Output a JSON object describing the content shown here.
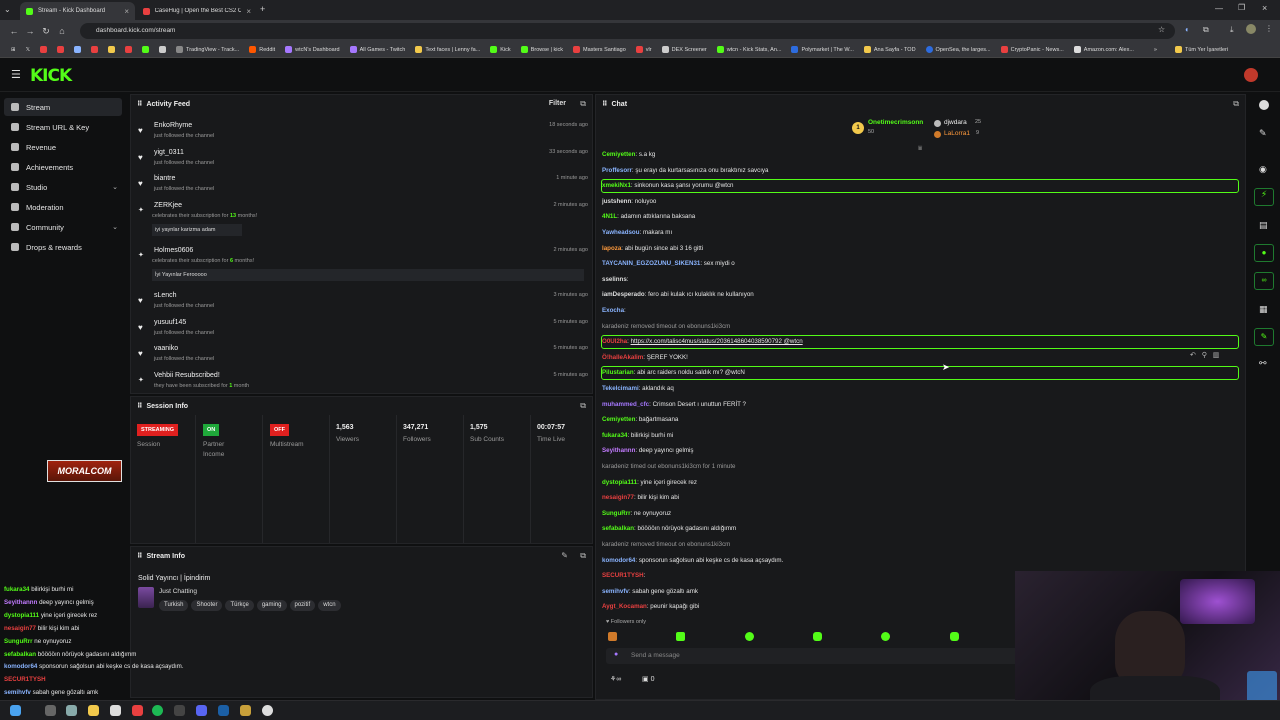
{
  "browser": {
    "tabs": [
      {
        "title": "Stream - Kick Dashboard",
        "active": true
      },
      {
        "title": "CaseHug | Open the Best CS2 C",
        "active": false
      }
    ],
    "url": "dashboard.kick.com/stream",
    "bookmarks": [
      "TradingView - Track...",
      "Reddit",
      "wtcN's Dashboard",
      "All Games - Twitch",
      "Text faces | Lenny fa...",
      "Kick",
      "Browse | kick",
      "Masters Santiago",
      "vlr",
      "DEX Screener",
      "wtcn - Kick Stats, An...",
      "Polymarket | The W...",
      "Ana Sayfa - TOD",
      "OpenSea, the larges...",
      "CryptoPanic - News...",
      "Amazon.com: Alex...",
      "Tüm Yer İşaretleri"
    ]
  },
  "header": {
    "logo": "KICK"
  },
  "sidebar": {
    "items": [
      {
        "label": "Stream",
        "active": true
      },
      {
        "label": "Stream URL & Key"
      },
      {
        "label": "Revenue"
      },
      {
        "label": "Achievements"
      },
      {
        "label": "Studio",
        "chevron": "⌄"
      },
      {
        "label": "Moderation"
      },
      {
        "label": "Community",
        "chevron": "⌄"
      },
      {
        "label": "Drops & rewards"
      }
    ]
  },
  "activity": {
    "title": "Activity Feed",
    "filter": "Filter",
    "items": [
      {
        "name": "EnkoRhyme",
        "desc": "just followed the channel",
        "time": "18 seconds ago"
      },
      {
        "name": "yigt_0311",
        "desc": "just followed the channel",
        "time": "33 seconds ago"
      },
      {
        "name": "biantre",
        "desc": "just followed the channel",
        "time": "1 minute ago"
      },
      {
        "name": "ZERKjee",
        "desc_pre": "celebrates their subscription for ",
        "months": "13",
        "desc_post": " months!",
        "time": "2 minutes ago",
        "msg": "iyi yaynlar karizma adam"
      },
      {
        "name": "Holmes0606",
        "desc_pre": "celebrates their subscription for ",
        "months": "6",
        "desc_post": " months!",
        "time": "2 minutes ago",
        "msg": "İyi Yayınlar Ferooooo"
      },
      {
        "name": "sLench",
        "desc": "just followed the channel",
        "time": "3 minutes ago"
      },
      {
        "name": "yusuuf145",
        "desc": "just followed the channel",
        "time": "5 minutes ago"
      },
      {
        "name": "vaaniko",
        "desc": "just followed the channel",
        "time": "5 minutes ago"
      },
      {
        "name": "Vehbii Resubscribed!",
        "desc_pre": "they have been subscribed for ",
        "months": "1",
        "desc_post": " month",
        "time": "5 minutes ago"
      }
    ]
  },
  "session": {
    "title": "Session Info",
    "streaming_badge": "STREAMING",
    "session_label": "Session",
    "partner_badge": "ON",
    "partner_label": "Partner Income",
    "multistream_badge": "OFF",
    "multistream_label": "Multistream",
    "viewers": "1,563",
    "viewers_label": "Viewers",
    "followers": "347,271",
    "followers_label": "Followers",
    "subs": "1,575",
    "subs_label": "Sub Counts",
    "time_live": "00:07:57",
    "time_live_label": "Time Live"
  },
  "stream_info": {
    "title": "Stream Info",
    "stream_title": "Solid Yayıncı | İpindirim",
    "category": "Just Chatting",
    "tags": [
      "Turkish",
      "Shooter",
      "Türkçe",
      "gaming",
      "pozitif",
      "wtcn"
    ]
  },
  "chat": {
    "title": "Chat",
    "top_gifters": [
      {
        "name": "Onetimecrimsonn",
        "count": "50"
      },
      {
        "name": "djwdara",
        "count": "25"
      },
      {
        "name": "LaLorra1",
        "count": "9"
      }
    ],
    "placeholder": "Send a message",
    "followers_only": "Followers only",
    "footer_count": "0",
    "messages": [
      {
        "user": "Cemiyetten",
        "text": "s.a kg",
        "color": "#53fc18"
      },
      {
        "user": "Proffesorr",
        "text": "şu erayı da kurtarsasınıza onu bıraktınız savcıya",
        "color": "#8ab4ff"
      },
      {
        "user": "xmekiNx1",
        "text": "sinkonun kasa şansı yorumu @wtcn",
        "color": "#53fc18",
        "highlight": true
      },
      {
        "user": "justshenn",
        "text": "noluyoo",
        "color": "#dddddd"
      },
      {
        "user": "4N1L",
        "text": "adamın attıklarına baksana",
        "color": "#53fc18"
      },
      {
        "user": "Yawheadsou",
        "text": "makara mı",
        "color": "#8ab4ff"
      },
      {
        "user": "lapoza",
        "text": "abi bugün since abi 3 16 gitti",
        "color": "#ff9a3c"
      },
      {
        "user": "TAYCANIN_EGZOZUNU_SIKEN31",
        "text": "sex miydi o",
        "color": "#8ab4ff"
      },
      {
        "user": "sselinns",
        "text": "",
        "color": "#dddddd"
      },
      {
        "user": "iamDesperado",
        "text": "fero abi kulak ıcı kulaklık ne kullanıyon",
        "color": "#dddddd"
      },
      {
        "user": "Exocha",
        "text": "",
        "color": "#8ab4ff"
      },
      {
        "user": "karadeniz",
        "text": "removed timeout on ebonuns1ki3cm",
        "system": true
      },
      {
        "user": "O0UI2ha",
        "text": "https://x.com/talisc4mus/status/2036148604038590792 @wtcn",
        "color": "#e94040",
        "highlight": true,
        "link": true
      },
      {
        "user": "Ö!halleAkalim",
        "text": "ŞEREF YOKK!",
        "color": "#e94040"
      },
      {
        "user": "Pilustarian",
        "text": "abi arc raiders noldu saldık mı? @wtcN",
        "color": "#53fc18",
        "highlight": true
      },
      {
        "user": "Tekelcimami",
        "text": "aklandık aq",
        "color": "#8ab4ff"
      },
      {
        "user": "muhammed_cfc",
        "text": "Crimson Desert ı unuttun FERİT ?",
        "color": "#a678ff"
      },
      {
        "user": "Cemiyetten",
        "text": "bağartmasana",
        "color": "#53fc18"
      },
      {
        "user": "fukara34",
        "text": "bilirkişi burhi mi",
        "color": "#53fc18"
      },
      {
        "user": "Seyithannn",
        "text": "deep yayıncı gelmiş",
        "color": "#c27bff"
      },
      {
        "user": "karadeniz",
        "text": "timed out ebonuns1ki3cm for 1 minute",
        "system": true
      },
      {
        "user": "dystopia111",
        "text": "yine içeri girecek rez",
        "color": "#53fc18"
      },
      {
        "user": "nesaigin77",
        "text": "bilir kişi kim abi",
        "color": "#e94040"
      },
      {
        "user": "SunguRrr",
        "text": "ne oynuyoruz",
        "color": "#53fc18"
      },
      {
        "user": "sefabalkan",
        "text": "bööööın nörüyok gadasını aldığımm",
        "color": "#53fc18"
      },
      {
        "user": "karadeniz",
        "text": "removed timeout on ebonuns1ki3cm",
        "system": true
      },
      {
        "user": "komodor64",
        "text": "sponsorun sağolsun abi keşke cs de kasa açsaydım.",
        "color": "#8ab4ff"
      },
      {
        "user": "SECUR1TYSH",
        "text": "",
        "color": "#e94040"
      },
      {
        "user": "semihvfv",
        "text": "sabah gene gözaltı amk",
        "color": "#8ab4ff"
      },
      {
        "user": "Aygt_Kocaman",
        "text": "peunir kapağı gibi",
        "color": "#e94040"
      }
    ]
  },
  "overlay_chat": [
    {
      "user": "fukara34",
      "text": "bilirkişi burhi mi",
      "color": "#53fc18"
    },
    {
      "user": "Seyithannn",
      "text": "deep yayıncı gelmiş",
      "color": "#c27bff"
    },
    {
      "user": "dystopia111",
      "text": "yine içeri girecek rez",
      "color": "#53fc18"
    },
    {
      "user": "nesaigin77",
      "text": "bilir kişi kim abi",
      "color": "#e94040"
    },
    {
      "user": "SunguRrr",
      "text": "ne oynuyoruz",
      "color": "#53fc18"
    },
    {
      "user": "sefabalkan",
      "text": "bööööın nörüyok gadasını aldığımm",
      "color": "#53fc18"
    },
    {
      "user": "komodor64",
      "text": "sponsorun sağolsun abi keşke cs de kasa açsaydım.",
      "color": "#8ab4ff"
    },
    {
      "user": "SECUR1TYSH",
      "text": "",
      "color": "#e94040"
    },
    {
      "user": "semihvfv",
      "text": "sabah gene gözaltı amk",
      "color": "#8ab4ff"
    },
    {
      "user": "Aygt_Kocaman",
      "text": "peunir kapağı gibi",
      "color": "#e94040"
    }
  ],
  "overlay_banner": "MORALCOM",
  "colors": {
    "accent": "#53fc18",
    "streaming": "#e0201f",
    "panel": "#18191b"
  }
}
